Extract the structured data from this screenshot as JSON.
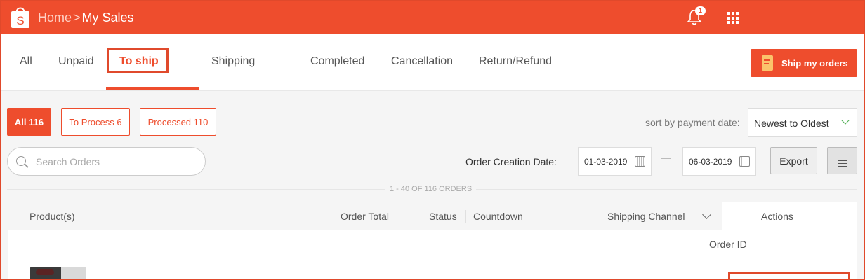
{
  "header": {
    "home_label": "Home",
    "separator": ">",
    "current_label": "My Sales",
    "notification_count": "1",
    "brand_color": "#ee4d2d"
  },
  "tabs": [
    {
      "label": "All"
    },
    {
      "label": "Unpaid"
    },
    {
      "label": "To ship",
      "active": true
    },
    {
      "label": "Shipping"
    },
    {
      "label": "Completed"
    },
    {
      "label": "Cancellation"
    },
    {
      "label": "Return/Refund"
    }
  ],
  "ship_button": {
    "label": "Ship my orders",
    "icon": "document-icon"
  },
  "filters": {
    "pills": [
      {
        "label": "All 116",
        "active": true
      },
      {
        "label": "To Process 6"
      },
      {
        "label": "Processed 110"
      }
    ],
    "sort_label": "sort by payment date:",
    "sort_value": "Newest to Oldest"
  },
  "search": {
    "placeholder": "Search Orders",
    "value": ""
  },
  "date_filter": {
    "label": "Order Creation Date:",
    "from": "01-03-2019",
    "to": "06-03-2019"
  },
  "export_label": "Export",
  "orders_count_text": "1 - 40 OF 116 ORDERS",
  "table": {
    "headers": {
      "product": "Product(s)",
      "total": "Order Total",
      "status": "Status",
      "countdown": "Countdown",
      "channel": "Shipping Channel",
      "actions": "Actions"
    },
    "order_id_label": "Order ID"
  }
}
